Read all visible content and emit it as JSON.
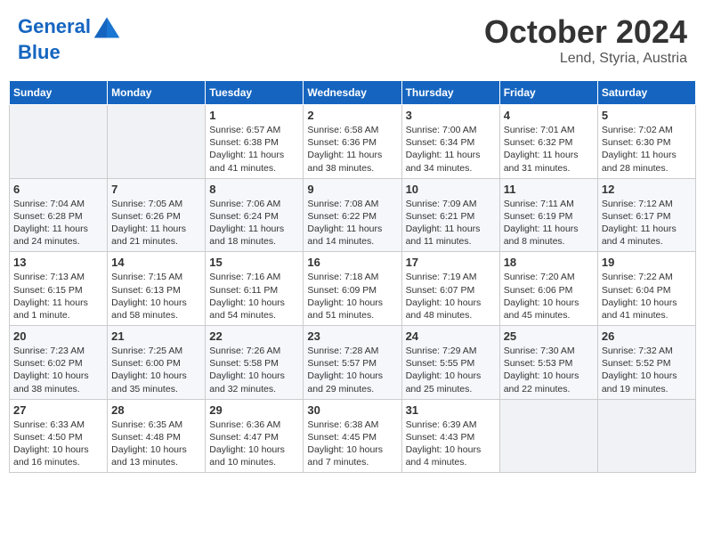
{
  "header": {
    "logo_line1": "General",
    "logo_line2": "Blue",
    "month": "October 2024",
    "location": "Lend, Styria, Austria"
  },
  "weekdays": [
    "Sunday",
    "Monday",
    "Tuesday",
    "Wednesday",
    "Thursday",
    "Friday",
    "Saturday"
  ],
  "weeks": [
    [
      {
        "day": "",
        "empty": true
      },
      {
        "day": "",
        "empty": true
      },
      {
        "day": "1",
        "rise": "6:57 AM",
        "set": "6:38 PM",
        "daylight": "11 hours and 41 minutes."
      },
      {
        "day": "2",
        "rise": "6:58 AM",
        "set": "6:36 PM",
        "daylight": "11 hours and 38 minutes."
      },
      {
        "day": "3",
        "rise": "7:00 AM",
        "set": "6:34 PM",
        "daylight": "11 hours and 34 minutes."
      },
      {
        "day": "4",
        "rise": "7:01 AM",
        "set": "6:32 PM",
        "daylight": "11 hours and 31 minutes."
      },
      {
        "day": "5",
        "rise": "7:02 AM",
        "set": "6:30 PM",
        "daylight": "11 hours and 28 minutes."
      }
    ],
    [
      {
        "day": "6",
        "rise": "7:04 AM",
        "set": "6:28 PM",
        "daylight": "11 hours and 24 minutes."
      },
      {
        "day": "7",
        "rise": "7:05 AM",
        "set": "6:26 PM",
        "daylight": "11 hours and 21 minutes."
      },
      {
        "day": "8",
        "rise": "7:06 AM",
        "set": "6:24 PM",
        "daylight": "11 hours and 18 minutes."
      },
      {
        "day": "9",
        "rise": "7:08 AM",
        "set": "6:22 PM",
        "daylight": "11 hours and 14 minutes."
      },
      {
        "day": "10",
        "rise": "7:09 AM",
        "set": "6:21 PM",
        "daylight": "11 hours and 11 minutes."
      },
      {
        "day": "11",
        "rise": "7:11 AM",
        "set": "6:19 PM",
        "daylight": "11 hours and 8 minutes."
      },
      {
        "day": "12",
        "rise": "7:12 AM",
        "set": "6:17 PM",
        "daylight": "11 hours and 4 minutes."
      }
    ],
    [
      {
        "day": "13",
        "rise": "7:13 AM",
        "set": "6:15 PM",
        "daylight": "11 hours and 1 minute."
      },
      {
        "day": "14",
        "rise": "7:15 AM",
        "set": "6:13 PM",
        "daylight": "10 hours and 58 minutes."
      },
      {
        "day": "15",
        "rise": "7:16 AM",
        "set": "6:11 PM",
        "daylight": "10 hours and 54 minutes."
      },
      {
        "day": "16",
        "rise": "7:18 AM",
        "set": "6:09 PM",
        "daylight": "10 hours and 51 minutes."
      },
      {
        "day": "17",
        "rise": "7:19 AM",
        "set": "6:07 PM",
        "daylight": "10 hours and 48 minutes."
      },
      {
        "day": "18",
        "rise": "7:20 AM",
        "set": "6:06 PM",
        "daylight": "10 hours and 45 minutes."
      },
      {
        "day": "19",
        "rise": "7:22 AM",
        "set": "6:04 PM",
        "daylight": "10 hours and 41 minutes."
      }
    ],
    [
      {
        "day": "20",
        "rise": "7:23 AM",
        "set": "6:02 PM",
        "daylight": "10 hours and 38 minutes."
      },
      {
        "day": "21",
        "rise": "7:25 AM",
        "set": "6:00 PM",
        "daylight": "10 hours and 35 minutes."
      },
      {
        "day": "22",
        "rise": "7:26 AM",
        "set": "5:58 PM",
        "daylight": "10 hours and 32 minutes."
      },
      {
        "day": "23",
        "rise": "7:28 AM",
        "set": "5:57 PM",
        "daylight": "10 hours and 29 minutes."
      },
      {
        "day": "24",
        "rise": "7:29 AM",
        "set": "5:55 PM",
        "daylight": "10 hours and 25 minutes."
      },
      {
        "day": "25",
        "rise": "7:30 AM",
        "set": "5:53 PM",
        "daylight": "10 hours and 22 minutes."
      },
      {
        "day": "26",
        "rise": "7:32 AM",
        "set": "5:52 PM",
        "daylight": "10 hours and 19 minutes."
      }
    ],
    [
      {
        "day": "27",
        "rise": "6:33 AM",
        "set": "4:50 PM",
        "daylight": "10 hours and 16 minutes."
      },
      {
        "day": "28",
        "rise": "6:35 AM",
        "set": "4:48 PM",
        "daylight": "10 hours and 13 minutes."
      },
      {
        "day": "29",
        "rise": "6:36 AM",
        "set": "4:47 PM",
        "daylight": "10 hours and 10 minutes."
      },
      {
        "day": "30",
        "rise": "6:38 AM",
        "set": "4:45 PM",
        "daylight": "10 hours and 7 minutes."
      },
      {
        "day": "31",
        "rise": "6:39 AM",
        "set": "4:43 PM",
        "daylight": "10 hours and 4 minutes."
      },
      {
        "day": "",
        "empty": true
      },
      {
        "day": "",
        "empty": true
      }
    ]
  ]
}
